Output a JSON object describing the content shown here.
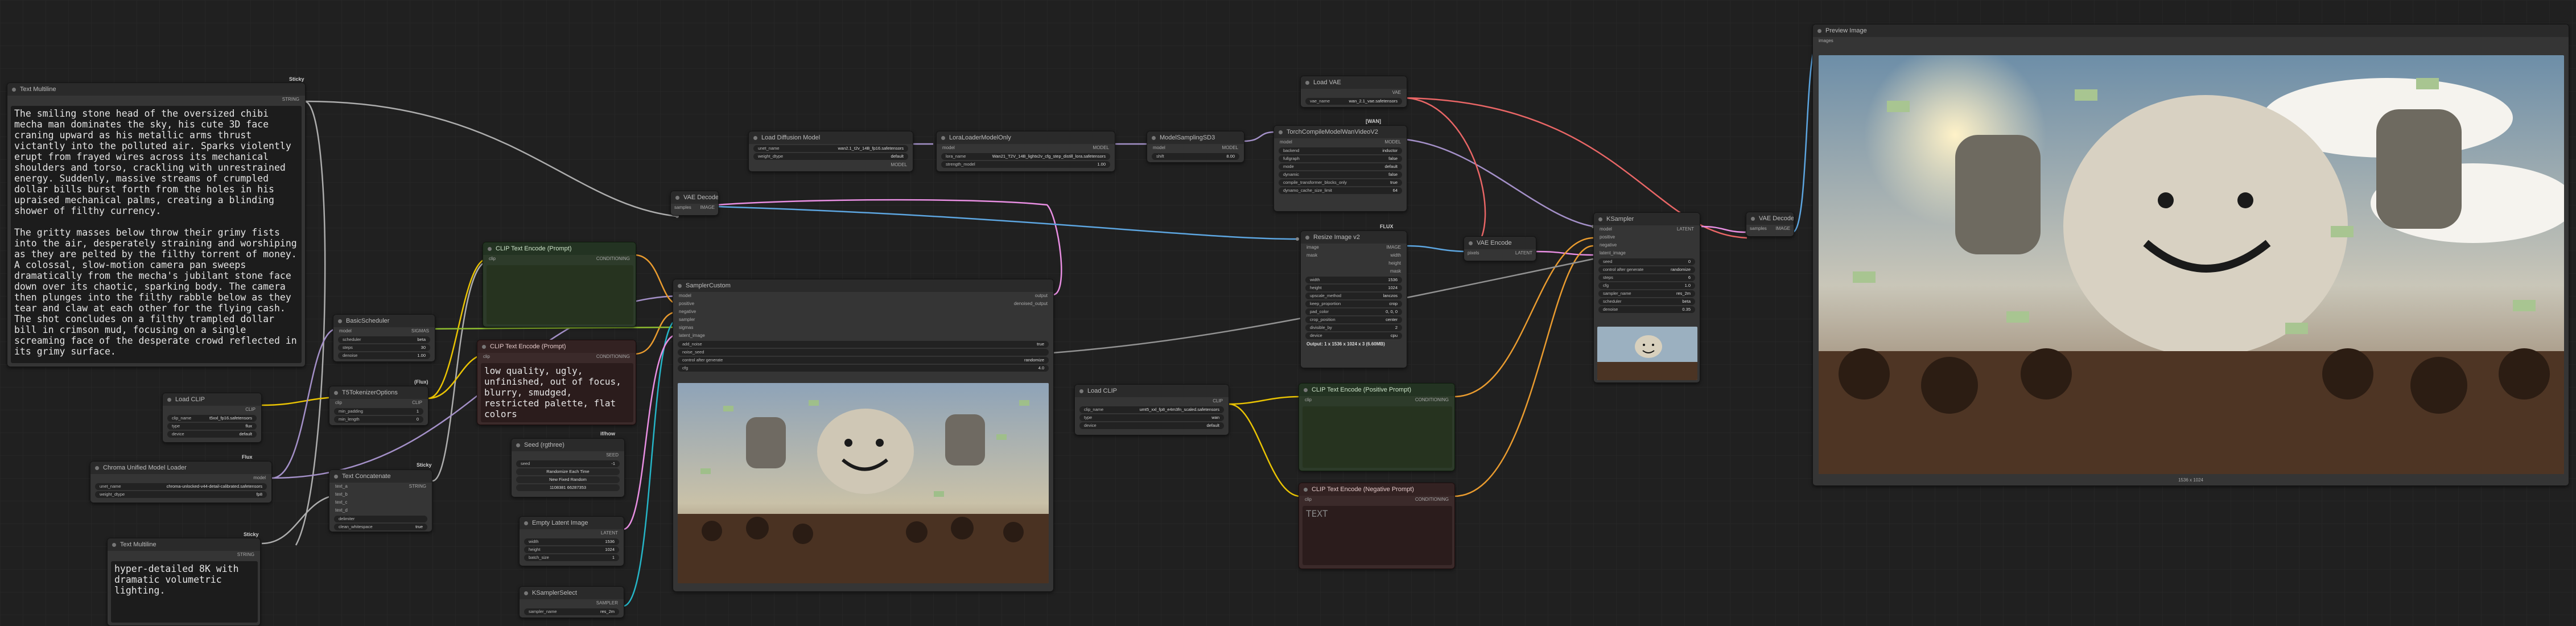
{
  "colors": {
    "clip": "#ffd500",
    "conditioning": "#ffa931",
    "model": "#b39ddb",
    "vae": "#ff6e6e",
    "latent": "#ff9cf9",
    "image": "#64b5f6",
    "string": "#a1a1a1",
    "int": "#7ee787"
  },
  "badges": {
    "sticky_top": "Sticky",
    "pos_tag": "CONDITIONING",
    "neg_tag": "CONDITIONING",
    "fluxtag": "Flux",
    "flux_right": "FLUX",
    "wan": "[WAN]",
    "ifhow": "if/how",
    "batch": "BATCH",
    "prompt_box": "(Flux)"
  },
  "nodes": {
    "text_multiline_1": {
      "title": "Text Multiline",
      "output": "STRING",
      "text": "The smiling stone head of the oversized chibi mecha man dominates the sky, his cute 3D face craning upward as his metallic arms thrust victantly into the polluted air. Sparks violently erupt from frayed wires across its mechanical shoulders and torso, crackling with unrestrained energy. Suddenly, massive streams of crumpled dollar bills burst forth from the holes in his upraised mechanical palms, creating a blinding shower of filthy currency.\n\nThe gritty masses below throw their grimy fists into the air, desperately straining and worshiping as they are pelted by the filthy torrent of money. A colossal, slow-motion camera pan sweeps dramatically from the mecha's jubilant stone face down over its chaotic, sparking body. The camera then plunges into the filthy rabble below as they tear and claw at each other for the flying cash. The shot concludes on a filthy trampled dollar bill in crimson mud, focusing on a single screaming face of the desperate crowd reflected in its grimy surface."
    },
    "text_multiline_2": {
      "title": "Text Multiline",
      "output": "STRING",
      "text": "hyper-detailed 8K with dramatic volumetric lighting."
    },
    "load_clip_1": {
      "title": "Load CLIP",
      "output": "CLIP",
      "w1_label": "clip_name",
      "w1_value": "t5xxl_fp16.safetensors",
      "w2_label": "type",
      "w2_value": "flux",
      "w3_label": "device",
      "w3_value": "default"
    },
    "chroma_loader": {
      "title": "Chroma Unified Model Loader",
      "output": "model",
      "w1_label": "unet_name",
      "w1_value": "chroma-unlocked-v44-detail-calibrated.safetensors",
      "w2_label": "weight_dtype",
      "w2_value": "fp8"
    },
    "basic_scheduler": {
      "title": "BasicScheduler",
      "in1": "model",
      "out1": "SIGMAS",
      "w1_label": "scheduler",
      "w1_value": "beta",
      "w2_label": "steps",
      "w2_value": "30",
      "w3_label": "denoise",
      "w3_value": "1.00"
    },
    "t5_tokenizer": {
      "title": "T5TokenizerOptions",
      "in1": "clip",
      "out1": "CLIP",
      "w1_label": "min_padding",
      "w1_value": "1",
      "w2_label": "min_length",
      "w2_value": "0"
    },
    "text_concatenate": {
      "title": "Text Concatenate",
      "out1": "STRING",
      "in1": "text_a",
      "in2": "text_b",
      "in3": "text_c",
      "in4": "text_d",
      "w1_label": "delimiter",
      "w1_value": "",
      "w2_label": "clean_whitespace",
      "w2_value": "true"
    },
    "clip_text_pos": {
      "title": "CLIP Text Encode (Prompt)",
      "in1": "clip",
      "out1": "CONDITIONING",
      "text": ""
    },
    "clip_text_neg": {
      "title": "CLIP Text Encode (Prompt)",
      "in1": "clip",
      "out1": "CONDITIONING",
      "text": "low quality, ugly, unfinished, out of focus, blurry, smudged, restricted palette, flat colors"
    },
    "seed": {
      "title": "Seed (rgthree)",
      "out1": "SEED",
      "w1_label": "seed",
      "w1_value": "-1",
      "btn1": "Randomize Each Time",
      "btn2": "New Fixed Random",
      "btn3": "1108381 66287353"
    },
    "empty_latent": {
      "title": "Empty Latent Image",
      "out1": "LATENT",
      "w1_label": "width",
      "w1_value": "1536",
      "w2_label": "height",
      "w2_value": "1024",
      "w3_label": "batch_size",
      "w3_value": "1"
    },
    "ksampler_select": {
      "title": "KSamplerSelect",
      "out1": "SAMPLER",
      "w1_label": "sampler_name",
      "w1_value": "res_2m"
    },
    "vae_decode_1": {
      "title": "VAE Decode",
      "in1": "samples",
      "in2": "vae",
      "out1": "IMAGE"
    },
    "sampler_custom": {
      "title": "SamplerCustom",
      "in": [
        "model",
        "positive",
        "negative",
        "sampler",
        "sigmas",
        "latent_image"
      ],
      "out1": "output",
      "out2": "denoised_output",
      "w1_label": "add_noise",
      "w1_value": "true",
      "w2_label": "noise_seed",
      "w2_value": "",
      "w3_label": "control after generate",
      "w3_value": "randomize",
      "w4_label": "cfg",
      "w4_value": "4.0"
    },
    "load_diffusion": {
      "title": "Load Diffusion Model",
      "out1": "MODEL",
      "w1_label": "unet_name",
      "w1_value": "wan2.1_t2v_14B_fp16.safetensors",
      "w2_label": "weight_dtype",
      "w2_value": "default"
    },
    "lora_loader": {
      "title": "LoraLoaderModelOnly",
      "in1": "model",
      "out1": "MODEL",
      "w1_label": "lora_name",
      "w1_value": "Wan21_T2V_14B_lightx2v_cfg_step_distill_lora.safetensors",
      "w2_label": "strength_model",
      "w2_value": "1.00"
    },
    "model_sampling": {
      "title": "ModelSamplingSD3",
      "in1": "model",
      "out1": "MODEL",
      "w1_label": "shift",
      "w1_value": "8.00"
    },
    "torch_compile": {
      "title": "TorchCompileModelWanVideoV2",
      "in1": "model",
      "out1": "MODEL",
      "w1_label": "backend",
      "w1_value": "inductor",
      "w2_label": "fullgraph",
      "w2_value": "false",
      "w3_label": "mode",
      "w3_value": "default",
      "w4_label": "dynamic",
      "w4_value": "false",
      "w5_label": "compile_transformer_blocks_only",
      "w5_value": "true",
      "w6_label": "dynamo_cache_size_limit",
      "w6_value": "64"
    },
    "load_vae": {
      "title": "Load VAE",
      "out1": "VAE",
      "w1_label": "vae_name",
      "w1_value": "wan_2.1_vae.safetensors"
    },
    "resize_image": {
      "title": "Resize Image v2",
      "in1": "image",
      "in2": "mask",
      "out1": "IMAGE",
      "out2": "width",
      "out3": "height",
      "out4": "mask",
      "w": [
        [
          "width",
          "1536"
        ],
        [
          "height",
          "1024"
        ],
        [
          "upscale_method",
          "lanczos"
        ],
        [
          "keep_proportion",
          "crop"
        ],
        [
          "pad_color",
          "0, 0, 0"
        ],
        [
          "crop_position",
          "center"
        ],
        [
          "divisible_by",
          "2"
        ],
        [
          "device",
          "cpu"
        ]
      ],
      "footer": "Output: 1 x 1536 x 1024 x 3 (6.60MB)"
    },
    "vae_encode": {
      "title": "VAE Encode",
      "in1": "pixels",
      "in2": "vae",
      "out1": "LATENT"
    },
    "load_clip_2": {
      "title": "Load CLIP",
      "out1": "CLIP",
      "w1_label": "clip_name",
      "w1_value": "umt5_xxl_fp8_e4m3fn_scaled.safetensors",
      "w2_label": "type",
      "w2_value": "wan",
      "w3_label": "device",
      "w3_value": "default"
    },
    "clip_pos2": {
      "title": "CLIP Text Encode (Positive Prompt)",
      "in1": "clip",
      "out1": "CONDITIONING",
      "text": ""
    },
    "clip_neg2": {
      "title": "CLIP Text Encode (Negative Prompt)",
      "in1": "clip",
      "out1": "CONDITIONING",
      "text": "TEXT"
    },
    "ksampler": {
      "title": "KSampler",
      "in": [
        "model",
        "positive",
        "negative",
        "latent_image"
      ],
      "out1": "LATENT",
      "w": [
        [
          "seed",
          "0"
        ],
        [
          "control after generate",
          "randomize"
        ],
        [
          "steps",
          "6"
        ],
        [
          "cfg",
          "1.0"
        ],
        [
          "sampler_name",
          "res_2m"
        ],
        [
          "scheduler",
          "beta"
        ],
        [
          "denoise",
          "0.35"
        ]
      ]
    },
    "vae_decode_2": {
      "title": "VAE Decode",
      "in1": "samples",
      "in2": "vae",
      "out1": "IMAGE"
    },
    "preview_image": {
      "title": "Preview Image",
      "in1": "images",
      "caption": "1536 x 1024"
    }
  }
}
